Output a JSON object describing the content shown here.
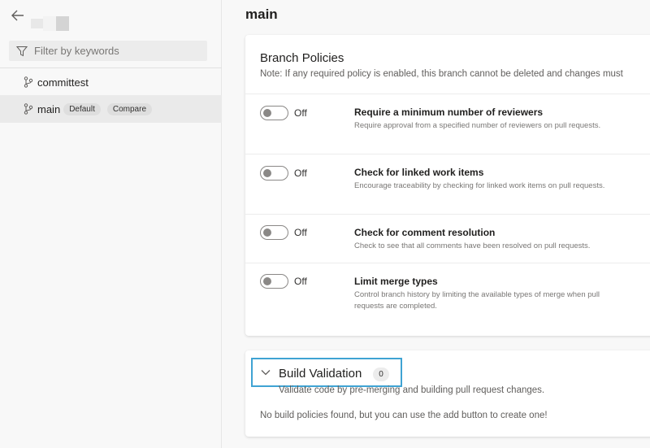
{
  "sidebar": {
    "filter_placeholder": "Filter by keywords",
    "branches": [
      {
        "name": "committest",
        "selected": false,
        "badges": []
      },
      {
        "name": "main",
        "selected": true,
        "badges": [
          "Default",
          "Compare"
        ]
      }
    ]
  },
  "page": {
    "title": "main"
  },
  "branch_policies": {
    "title": "Branch Policies",
    "note": "Note: If any required policy is enabled, this branch cannot be deleted and changes must",
    "policies": [
      {
        "state": "Off",
        "title": "Require a minimum number of reviewers",
        "description": "Require approval from a specified number of reviewers on pull requests."
      },
      {
        "state": "Off",
        "title": "Check for linked work items",
        "description": "Encourage traceability by checking for linked work items on pull requests."
      },
      {
        "state": "Off",
        "title": "Check for comment resolution",
        "description": "Check to see that all comments have been resolved on pull requests."
      },
      {
        "state": "Off",
        "title": "Limit merge types",
        "description": "Control branch history by limiting the available types of merge when pull requests are completed."
      }
    ]
  },
  "build_validation": {
    "title": "Build Validation",
    "count": "0",
    "description": "Validate code by pre-merging and building pull request changes.",
    "empty_text": "No build policies found, but you can use the add button to create one!"
  },
  "colors": {
    "highlight_border": "#3fa3d3",
    "selected_row": "#eaeaea",
    "toggle_off": "#8a8886"
  }
}
